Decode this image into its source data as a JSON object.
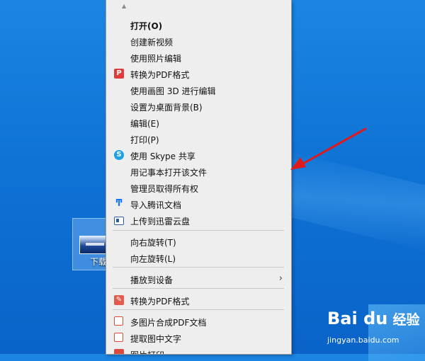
{
  "desktop": {
    "icon_label": "下载"
  },
  "menu": {
    "items": [
      {
        "label": "打开(O)",
        "bold": true
      },
      {
        "label": "创建新视频"
      },
      {
        "label": "使用照片编辑"
      },
      {
        "label": "转换为PDF格式",
        "icon": "pdf-convert-icon"
      },
      {
        "label": "使用画图 3D 进行编辑"
      },
      {
        "label": "设置为桌面背景(B)"
      },
      {
        "label": "编辑(E)"
      },
      {
        "label": "打印(P)"
      },
      {
        "label": "使用 Skype 共享",
        "icon": "skype-icon"
      },
      {
        "label": "用记事本打开该文件"
      },
      {
        "label": "管理员取得所有权"
      },
      {
        "label": "导入腾讯文档",
        "icon": "tencent-docs-icon"
      },
      {
        "label": "上传到迅雷云盘",
        "icon": "xunlei-cloud-icon"
      },
      {
        "label": "向右旋转(T)"
      },
      {
        "label": "向左旋转(L)"
      },
      {
        "label": "播放到设备",
        "submenu": true
      },
      {
        "label": "转换为PDF格式",
        "icon": "pdf-pen-icon"
      },
      {
        "label": "多图片合成PDF文档",
        "icon": "merge-pdf-icon"
      },
      {
        "label": "提取图中文字",
        "icon": "extract-text-icon"
      },
      {
        "label": "图片打印",
        "icon": "image-print-icon"
      }
    ]
  },
  "watermark": {
    "logo": "Bai du",
    "brand_cn": "经验",
    "url": "jingyan.baidu.com"
  },
  "colors": {
    "desktop_blue": "#0f73d6",
    "menu_bg": "#eeeeee",
    "arrow_red": "#e0191b"
  }
}
